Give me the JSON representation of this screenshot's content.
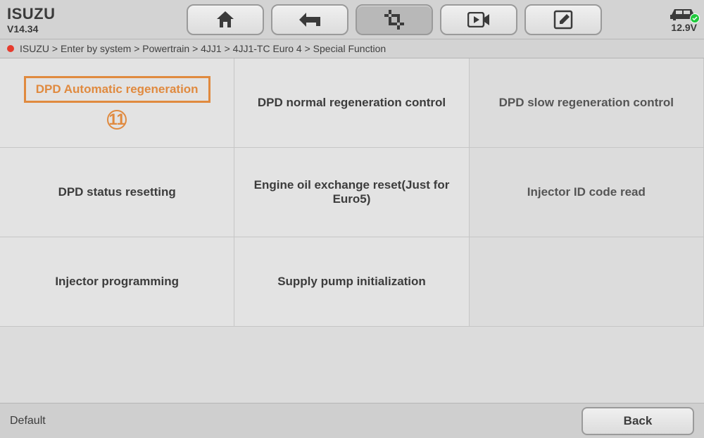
{
  "header": {
    "brand": "ISUZU",
    "version": "V14.34",
    "voltage": "12.9V"
  },
  "breadcrumb": "ISUZU > Enter by system > Powertrain > 4JJ1 > 4JJ1-TC Euro 4 > Special Function",
  "grid": {
    "cells": [
      "DPD Automatic regeneration",
      "DPD normal regeneration control",
      "DPD slow regeneration control",
      "DPD status resetting",
      "Engine oil exchange reset(Just for Euro5)",
      "Injector ID code read",
      "Injector programming",
      "Supply pump initialization"
    ],
    "step_marker": "⑪"
  },
  "footer": {
    "status": "Default",
    "back": "Back"
  }
}
